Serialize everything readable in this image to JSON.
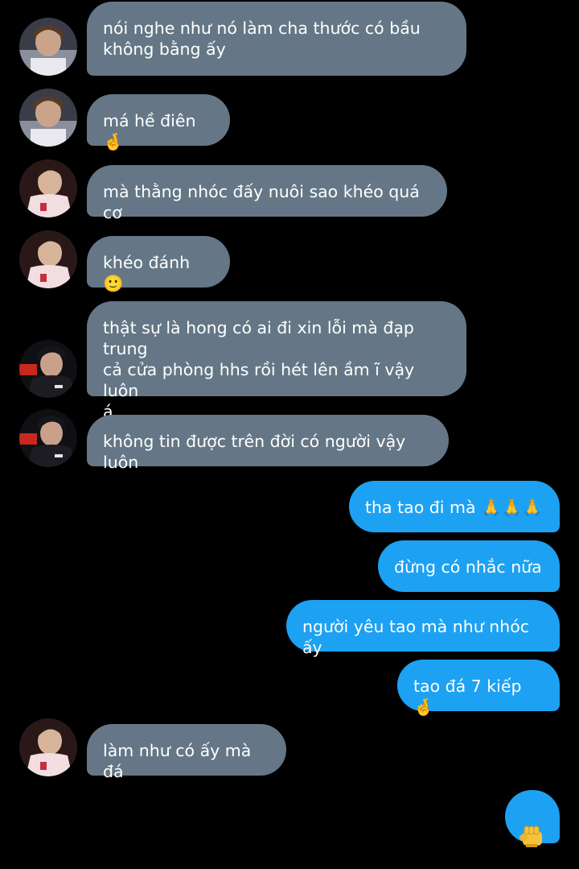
{
  "conversation": {
    "messages": [
      {
        "side": "received",
        "avatar": "avatar-a",
        "text": "nói nghe như nó làm cha thước có bầu\nkhông bằng ấy"
      },
      {
        "side": "received",
        "avatar": "avatar-a",
        "text": "má hề điên 🤞"
      },
      {
        "side": "received",
        "avatar": "avatar-b",
        "text": "mà thằng nhóc đấy nuôi sao khéo quá cơ"
      },
      {
        "side": "received",
        "avatar": "avatar-b",
        "text": "khéo đánh 🙂"
      },
      {
        "side": "received",
        "avatar": "avatar-c",
        "text": "thật sự là hong có ai đi xin lỗi mà đạp trung\ncả cửa phòng hhs rồi hét lên ầm ĩ vậy luôn\ná"
      },
      {
        "side": "received",
        "avatar": "avatar-c",
        "text": "không tin được trên đời có người vậy luôn"
      },
      {
        "side": "sent",
        "text": "tha tao đi mà 🙏🙏🙏"
      },
      {
        "side": "sent",
        "text": "đừng có nhắc nữa"
      },
      {
        "side": "sent",
        "text": "người yêu tao mà như nhóc ấy"
      },
      {
        "side": "sent",
        "text": "tao đá 7 kiếp 🤞"
      },
      {
        "side": "received",
        "avatar": "avatar-b",
        "text": "làm như có ấy mà đá"
      },
      {
        "side": "sent",
        "text": "👊"
      }
    ]
  },
  "colors": {
    "background": "#000000",
    "received_bubble": "#657786",
    "sent_bubble": "#1da1f2",
    "text": "#ffffff"
  }
}
